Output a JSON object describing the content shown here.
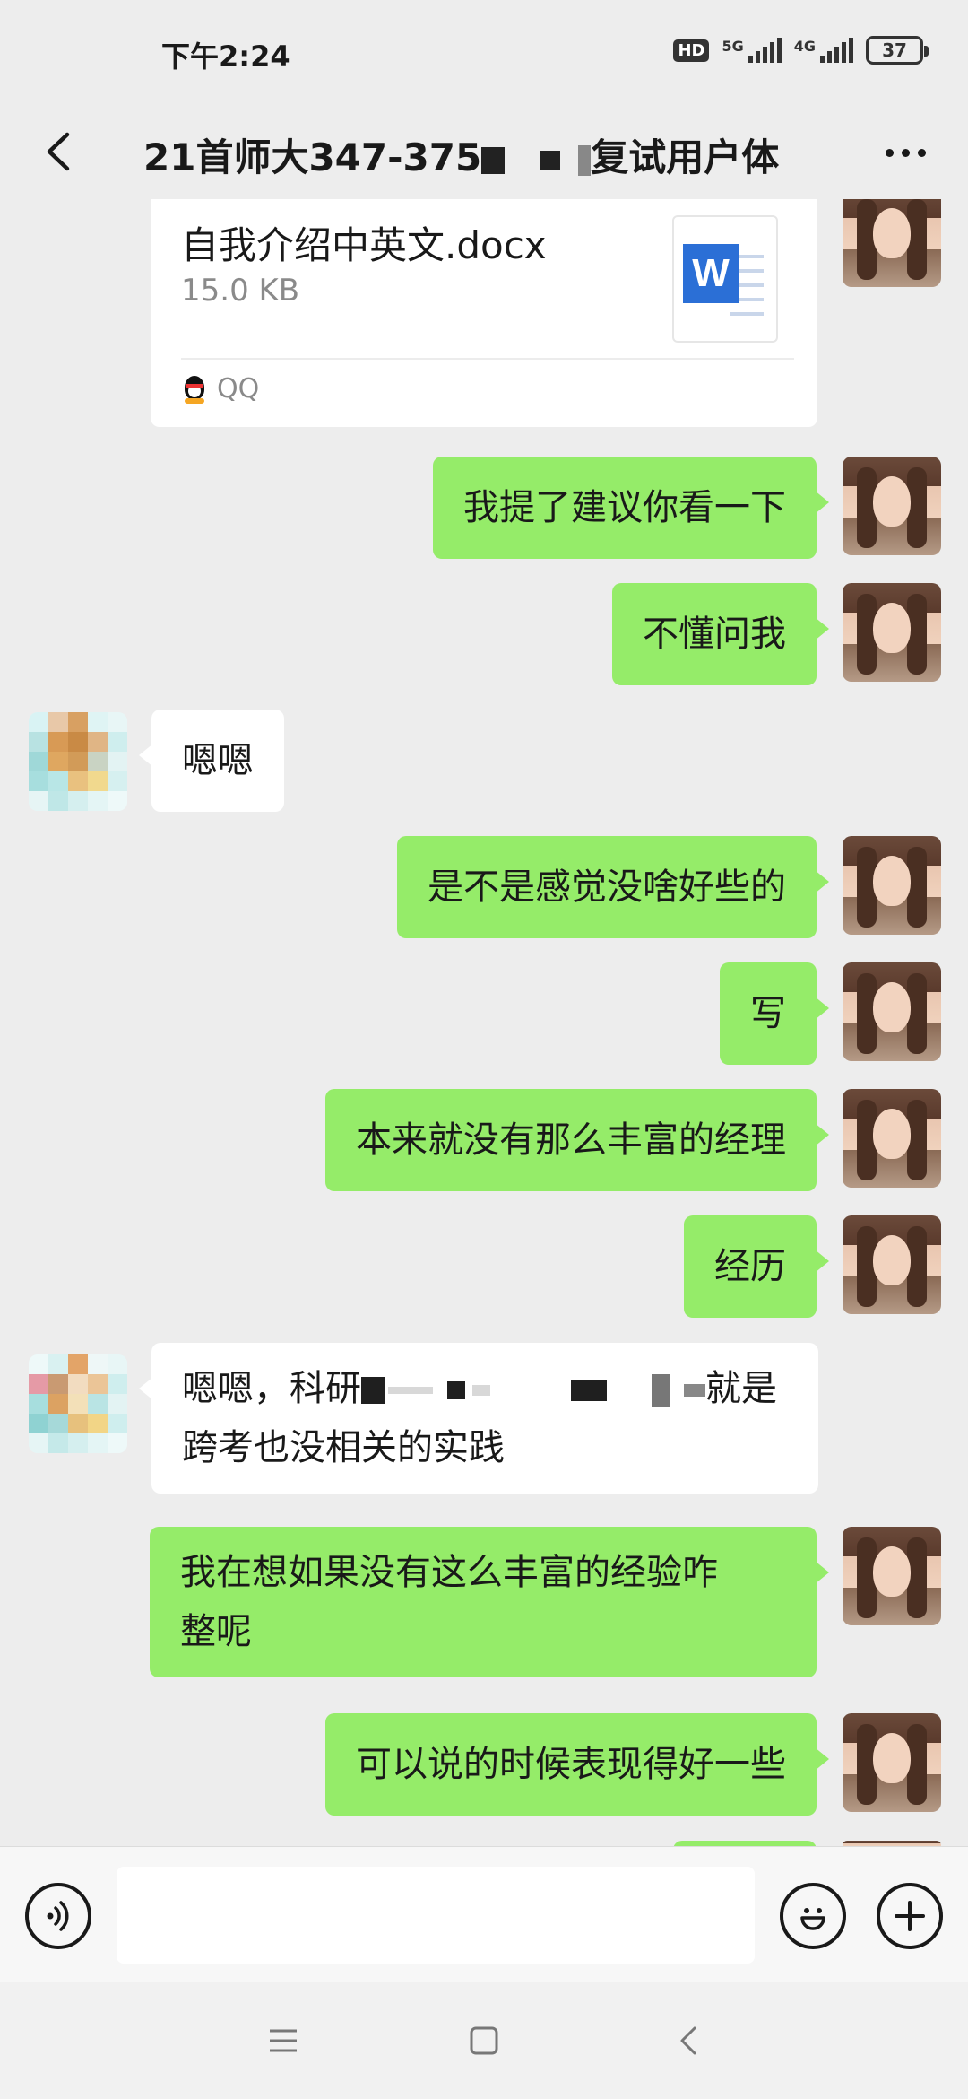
{
  "status_bar": {
    "time": "下午2:24",
    "hd": "HD",
    "net1": "5G",
    "net2": "4G",
    "battery": "37"
  },
  "header": {
    "title_part1": "21首师大347-375",
    "title_part2": "复试用户体"
  },
  "file_message": {
    "file_name": "自我介绍中英文.docx",
    "file_size": "15.0 KB",
    "file_icon_letter": "W",
    "source": "QQ"
  },
  "messages": [
    {
      "sender": "me",
      "text": "我提了建议你看一下"
    },
    {
      "sender": "me",
      "text": "不懂问我"
    },
    {
      "sender": "other",
      "text": "嗯嗯"
    },
    {
      "sender": "me",
      "text": "是不是感觉没啥好些的"
    },
    {
      "sender": "me",
      "text": "写"
    },
    {
      "sender": "me",
      "text": "本来就没有那么丰富的经理"
    },
    {
      "sender": "me",
      "text": "经历"
    },
    {
      "sender": "other",
      "text_start": "嗯嗯，科研",
      "text_end": "就是",
      "text_line2": "跨考也没相关的实践"
    },
    {
      "sender": "me",
      "text_line1": "我在想如果没有这么丰富的经验咋",
      "text_line2": "整呢"
    },
    {
      "sender": "me",
      "text": "可以说的时候表现得好一些"
    }
  ],
  "colors": {
    "background": "#ededed",
    "bubble_me": "#95ec69",
    "bubble_other": "#ffffff",
    "word_blue": "#2b6fd6"
  },
  "icons": {
    "back": "chevron-left-icon",
    "more": "more-dots-icon",
    "voice": "voice-icon",
    "emoji": "emoji-icon",
    "plus": "plus-icon"
  }
}
